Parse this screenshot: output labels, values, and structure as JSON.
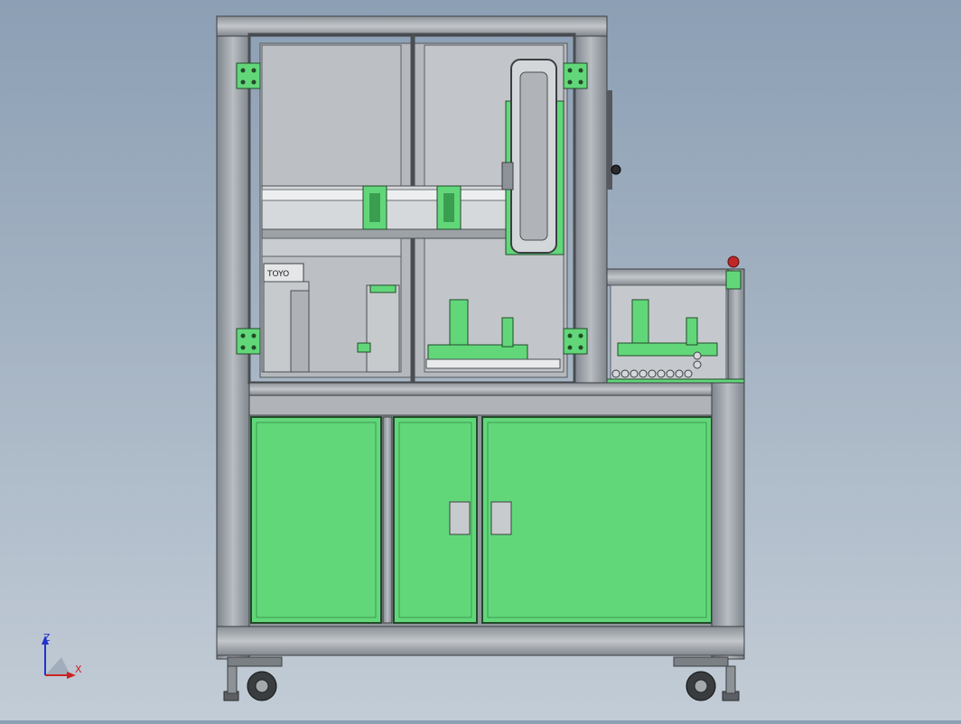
{
  "triad": {
    "z_label": "Z",
    "x_label": "X",
    "z_color": "#2233cc",
    "x_color": "#cc2222"
  },
  "model": {
    "frame_color": "#9aa0a6",
    "panel_color": "#62d77a",
    "glass_color": "#b8bcc0",
    "part_label": "TOYO"
  }
}
